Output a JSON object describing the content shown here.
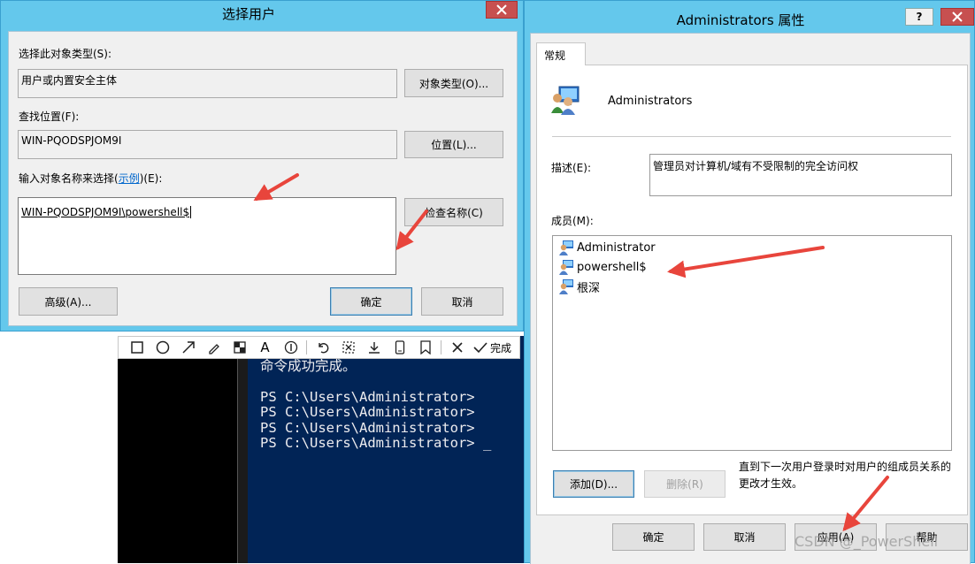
{
  "background": {
    "powershell_lines": [
      "命令成功完成。",
      "PS C:\\Users\\Administrator> ",
      "PS C:\\Users\\Administrator> ",
      "PS C:\\Users\\Administrator> ",
      "PS C:\\Users\\Administrator> _"
    ],
    "capture_toolbar": {
      "done_label": "完成",
      "tools": [
        "rectangle-icon",
        "ellipse-icon",
        "arrow-icon",
        "pen-icon",
        "mosaic-icon",
        "text-icon",
        "number-marker-icon",
        "undo-icon",
        "crop-icon",
        "download-icon",
        "pin-icon",
        "bookmark-icon",
        "cancel-icon",
        "check-icon"
      ]
    }
  },
  "select_user": {
    "title": "选择用户",
    "object_type_label": "选择此对象类型(S):",
    "object_type_value": "用户或内置安全主体",
    "object_types_button": "对象类型(O)...",
    "location_label": "查找位置(F):",
    "location_value": "WIN-PQODSPJOM9I",
    "locations_button": "位置(L)...",
    "names_label_pre": "输入对象名称来选择(",
    "names_label_link": "示例",
    "names_label_post": ")(E):",
    "names_value": "WIN-PQODSPJOM9I\\powershell$",
    "check_names_button": "检查名称(C)",
    "advanced_button": "高级(A)...",
    "ok_button": "确定",
    "cancel_button": "取消"
  },
  "admin_props": {
    "title": "Administrators 属性",
    "help_label": "?",
    "tab_general": "常规",
    "group_name": "Administrators",
    "description_label": "描述(E):",
    "description_value": "管理员对计算机/域有不受限制的完全访问权",
    "members_label": "成员(M):",
    "members": [
      "Administrator",
      "powershell$",
      "根深"
    ],
    "add_button": "添加(D)...",
    "remove_button": "删除(R)",
    "note": "直到下一次用户登录时对用户的组成员关系的更改才生效。",
    "ok_button": "确定",
    "cancel_button": "取消",
    "apply_button": "应用(A)",
    "help_button": "帮助"
  },
  "watermark": "CSDN @_PowerShell",
  "colors": {
    "title_bar": "#64c8ec",
    "close_button": "#c75050",
    "powershell_bg": "#012456",
    "annotation_arrow": "#e8453c"
  }
}
